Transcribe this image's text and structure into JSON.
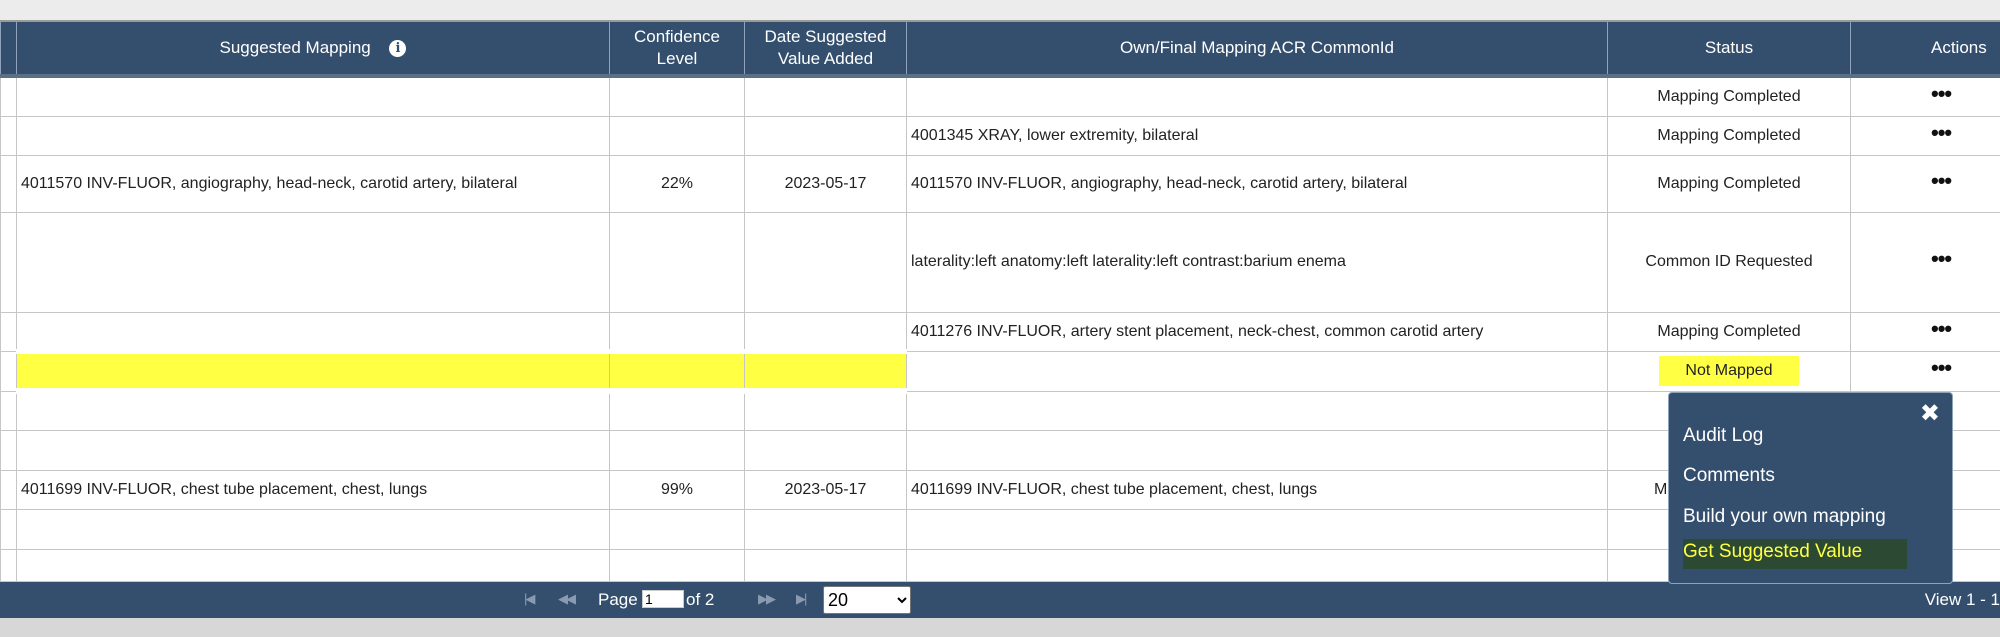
{
  "columns": {
    "suggested_mapping": "Suggested Mapping",
    "confidence_level": "Confidence\nLevel",
    "date_suggested": "Date Suggested\nValue Added",
    "own_final_mapping": "Own/Final Mapping ACR CommonId",
    "status": "Status",
    "actions": "Actions"
  },
  "info_icon_glyph": "i",
  "actions_glyph": "•••",
  "rows": [
    {
      "suggested": "",
      "confidence": "",
      "date": "",
      "own": "",
      "status": "Mapping Completed"
    },
    {
      "suggested": "",
      "confidence": "",
      "date": "",
      "own": "4001345 XRAY, lower extremity, bilateral",
      "status": "Mapping Completed"
    },
    {
      "suggested": "4011570 INV-FLUOR, angiography, head-neck, carotid artery, bilateral",
      "confidence": "22%",
      "date": "2023-05-17",
      "own": "4011570 INV-FLUOR, angiography, head-neck, carotid artery, bilateral",
      "status": "Mapping Completed"
    },
    {
      "suggested": "",
      "confidence": "",
      "date": "",
      "own": "laterality:left\n anatomy:left\n laterality:left\n contrast:barium enema",
      "status": "Common ID Requested"
    },
    {
      "suggested": "",
      "confidence": "",
      "date": "",
      "own": "4011276 INV-FLUOR, artery stent placement, neck-chest, common carotid artery",
      "status": "Mapping Completed"
    },
    {
      "suggested": "",
      "confidence": "",
      "date": "",
      "own": "",
      "status": "Not Mapped"
    },
    {
      "suggested": "",
      "confidence": "",
      "date": "",
      "own": "",
      "status": ""
    },
    {
      "suggested": "",
      "confidence": "",
      "date": "",
      "own": "",
      "status": ""
    },
    {
      "suggested": "4011699 INV-FLUOR, chest tube placement, chest, lungs",
      "confidence": "99%",
      "date": "2023-05-17",
      "own": "4011699 INV-FLUOR, chest tube placement, chest, lungs",
      "status": "M"
    },
    {
      "suggested": "",
      "confidence": "",
      "date": "",
      "own": "",
      "status": ""
    },
    {
      "suggested": "",
      "confidence": "",
      "date": "",
      "own": "",
      "status": ""
    }
  ],
  "pager": {
    "first_glyph": "|◀",
    "prev_glyph": "◀◀",
    "next_glyph": "▶▶",
    "last_glyph": "▶|",
    "page_label": "Page",
    "current_page": "1",
    "of_label": "of 2",
    "page_size": "20",
    "view_label": "View 1 - 1"
  },
  "action_menu": {
    "close_glyph": "✖",
    "items": [
      "Audit Log",
      "Comments",
      "Build your own mapping",
      "Get Suggested Value"
    ]
  },
  "colors": {
    "header_bg": "#344f6e",
    "highlight": "#ffff44"
  }
}
